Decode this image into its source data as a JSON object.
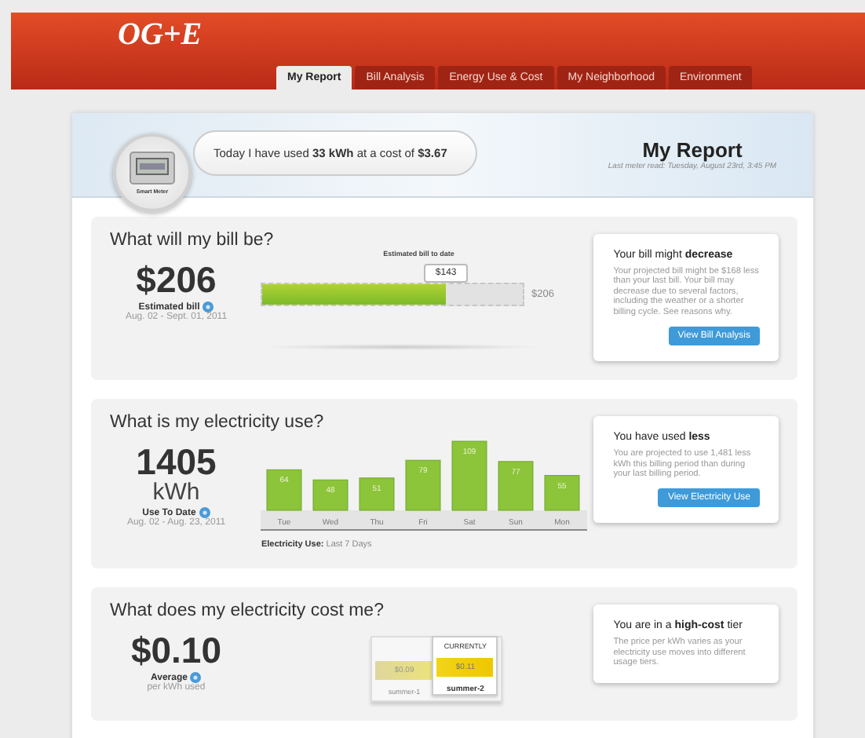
{
  "header": {
    "logo": "OG+E",
    "tabs": [
      {
        "label": "My Report",
        "selected": true
      },
      {
        "label": "Bill Analysis",
        "selected": false
      },
      {
        "label": "Energy Use & Cost",
        "selected": false
      },
      {
        "label": "My Neighborhood",
        "selected": false
      },
      {
        "label": "Environment",
        "selected": false
      }
    ]
  },
  "banner": {
    "message": "Today I have used **33 kWh** at a cost of **$3.67**",
    "meter_label": "Smart Meter",
    "title": "My Report",
    "subtitle": "Last meter read: Tuesday, August 23rd, 3:45 PM"
  },
  "sections": [
    {
      "kind": "bill",
      "question": "What will my bill be?",
      "amount": "$206",
      "amount_label": "Estimated bill",
      "period": "Aug. 02 - Sept. 01, 2011",
      "bar": {
        "caption": "Estimated bill to date",
        "callout": "$143",
        "level": 0.7,
        "end_label": "$206"
      },
      "card": {
        "title": "Your bill might **decrease**",
        "body": "Your projected bill might be $168 less than your last bill. Your bill may decrease due to several factors, including the weather or a shorter billing cycle. See reasons why.",
        "button": "View Bill Analysis"
      }
    },
    {
      "kind": "usage",
      "question": "What is my electricity use?",
      "amount": "1405",
      "unit": "kWh",
      "amount_label": "Use To Date",
      "period": "Aug. 02 - Aug. 23, 2011",
      "chart_data": {
        "type": "bar",
        "categories": [
          "Tue",
          "Wed",
          "Thu",
          "Fri",
          "Sat",
          "Sun",
          "Mon"
        ],
        "values": [
          64,
          48,
          51,
          79,
          109,
          77,
          55
        ],
        "data_labels": true
      },
      "chart_caption": "**Electricity Use:** Last 7 Days",
      "card": {
        "title": "You have used **less**",
        "body": "You are projected to use 1,481 less kWh this billing period than during your last billing period.",
        "button": "View Electricity Use"
      }
    },
    {
      "kind": "cost",
      "question": "What does my electricity cost me?",
      "amount": "$0.10",
      "amount_label": "Average",
      "unit": "per kWh used",
      "current_label": "CURRENTLY",
      "tiers": [
        {
          "label": "summer-1",
          "price": "$0.09",
          "selected": false
        },
        {
          "label": "summer-2",
          "price": "$0.11",
          "selected": true
        }
      ],
      "card": {
        "title": "You are in a **high-cost** tier",
        "body": "The price per kWh varies as your electricity use moves into different usage tiers."
      }
    }
  ]
}
